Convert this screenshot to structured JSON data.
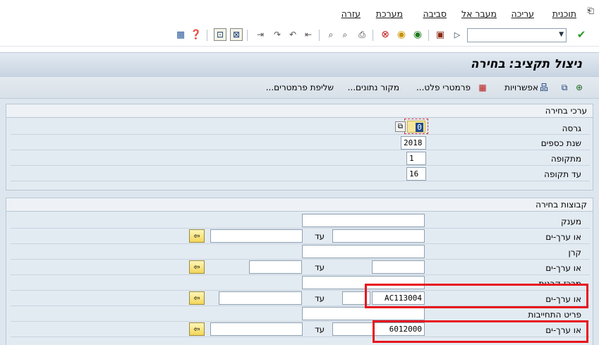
{
  "menu": {
    "program": "תוכנית",
    "edit": "עריכה",
    "goto": "מעבר אל",
    "environment": "סביבה",
    "system": "מערכת",
    "help": "עזרה"
  },
  "toolbar": {
    "command_value": ""
  },
  "title": "ניצול תקציב: בחירה",
  "apptoolbar": {
    "options": "אפשרויות",
    "output_params": "פרמטרי פלט...",
    "data_source": "מקור נתונים...",
    "fetch_params": "שליפת פרמטרים..."
  },
  "selection_values": {
    "title": "ערכי בחירה",
    "version_label": "גרסה",
    "version_value": "0",
    "fiscal_year_label": "שנת כספים",
    "fiscal_year_value": "2018",
    "period_label": "מתקופה",
    "period_value": "1",
    "to_period_label": "עד תקופה",
    "to_period_value": "16"
  },
  "selection_groups": {
    "title": "קבוצות בחירה",
    "grantor_label": "מענק",
    "or_values_label": "או ערך-ים",
    "to_label": "עד",
    "fund_label": "קרן",
    "funds_center_label": "מרכז קרנות",
    "funds_center_value": "AC113004",
    "commitment_item_label": "פריט התחייבות",
    "commitment_item_value": "6012000"
  },
  "colors": {
    "highlight": "#e8141e",
    "panel_bg": "#e3ebf2",
    "title_bg": "#c9d5e2"
  }
}
